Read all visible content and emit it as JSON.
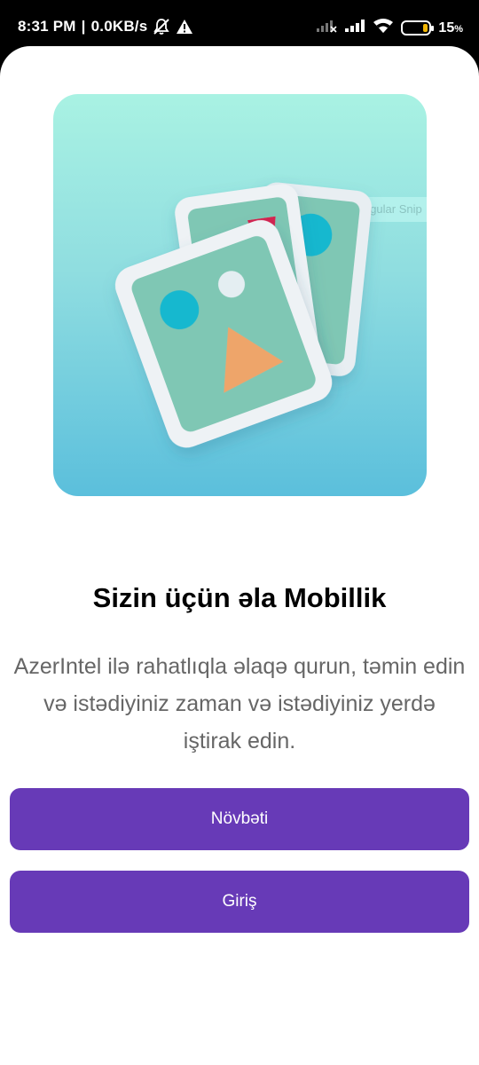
{
  "status_bar": {
    "time": "8:31 PM",
    "separator": "|",
    "network_speed": "0.0KB/s",
    "battery_percent": "15",
    "battery_unit": "%",
    "battery_color": "#f2b705",
    "icons": [
      "bell-off-icon",
      "warning-icon",
      "signal-icon",
      "signal-icon",
      "wifi-icon",
      "battery-icon"
    ]
  },
  "hero": {
    "overlay_text": "Rectangular Snip"
  },
  "onboarding": {
    "title": "Sizin üçün əla Mobillik",
    "description": "AzerIntel ilə rahatlıqla əlaqə qurun, təmin edin və istədiyiniz zaman və istədiyiniz yerdə iştirak edin.",
    "next_label": "Növbəti",
    "login_label": "Giriş"
  },
  "colors": {
    "accent": "#673ab7",
    "hero_top": "#a9f2e3",
    "hero_bottom": "#5bbfdc"
  }
}
